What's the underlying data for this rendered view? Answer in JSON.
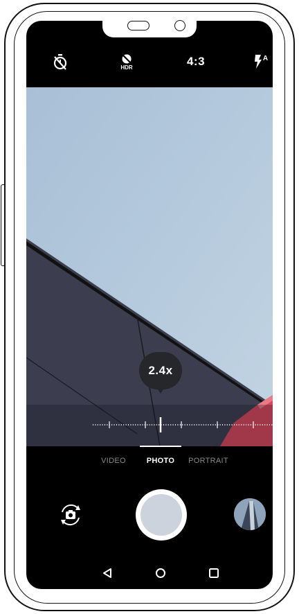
{
  "camera": {
    "top_bar": {
      "timer_icon": "timer-off-icon",
      "hdr_label": "HDR",
      "aspect_ratio": "4:3",
      "flash_label": "A"
    },
    "zoom": {
      "level_label": "2.4x",
      "level": 2.4
    },
    "modes": {
      "items": [
        "VIDEO",
        "PHOTO",
        "PORTRAIT"
      ],
      "selected": "PHOTO"
    },
    "controls": {
      "switch_camera_icon": "switch-camera-icon",
      "shutter_icon": "shutter-button",
      "gallery_icon": "gallery-thumbnail"
    },
    "nav": {
      "back_icon": "back-icon",
      "home_icon": "home-icon",
      "recents_icon": "recents-icon"
    }
  },
  "colors": {
    "sky": "#b3c8dc",
    "wall": "#3e3f50",
    "accent_red": "#d8475c",
    "screen_bg": "#000000"
  }
}
